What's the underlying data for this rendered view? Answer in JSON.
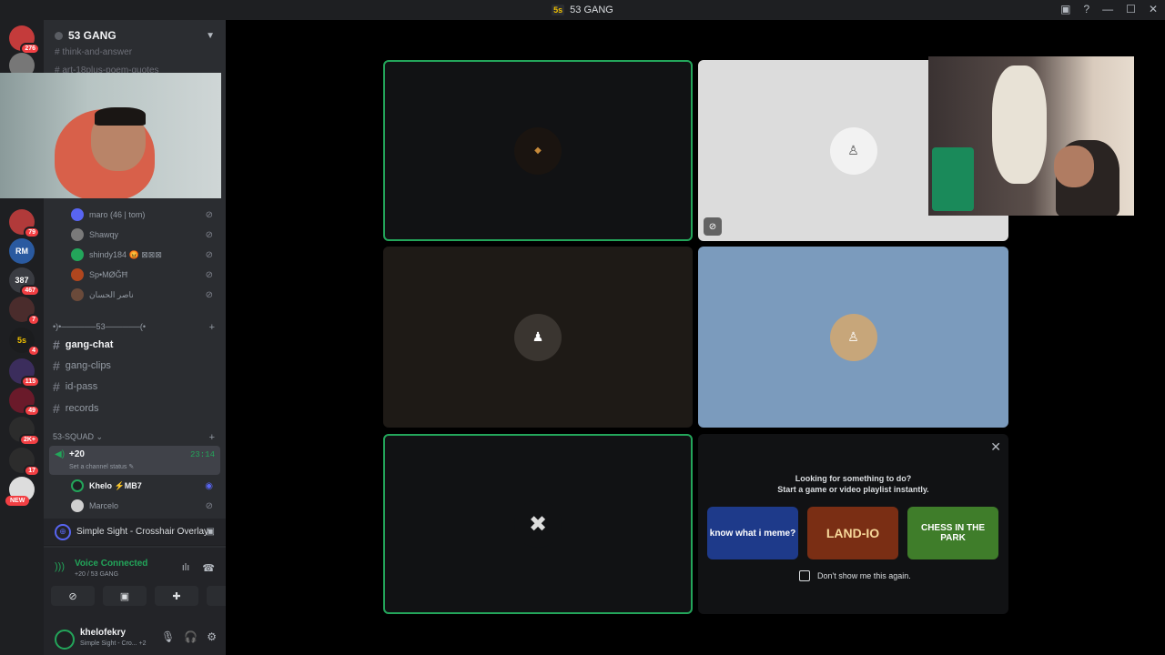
{
  "window": {
    "title": "53 GANG",
    "logo": "5s"
  },
  "guilds": [
    {
      "label": "",
      "badge": "276",
      "color": "#c43b3b"
    },
    {
      "label": "",
      "badge": "",
      "color": "#777"
    },
    {
      "label": "",
      "badge": "79",
      "color": "#b13a3a"
    },
    {
      "label": "RM",
      "badge": "",
      "color": "#2a5aa0"
    },
    {
      "label": "387",
      "badge": "467",
      "color": "#3a3c42"
    },
    {
      "label": "",
      "badge": "7",
      "color": "#4a2c2c"
    },
    {
      "label": "5s",
      "badge": "4",
      "color": "#1b1c1e"
    },
    {
      "label": "",
      "badge": "115",
      "color": "#3b2d5c"
    },
    {
      "label": "",
      "badge": "49",
      "color": "#6a1a2a"
    },
    {
      "label": "",
      "badge": "2K+",
      "color": "#2c2c2c"
    },
    {
      "label": "",
      "badge": "17",
      "color": "#2c2c2c"
    },
    {
      "label": "",
      "badge": "",
      "color": "#ddd"
    }
  ],
  "new_badge": "NEW",
  "server": {
    "name": "53 GANG"
  },
  "ghost_channels": [
    "think-and-answer",
    "art-18plus-poem-quotes"
  ],
  "voice_members_top": [
    {
      "name": "maro (46 | tom)",
      "color": "#5865f2"
    },
    {
      "name": "Shawqy",
      "color": "#7a7a7a"
    },
    {
      "name": "shindy184 😡 ⊠⊠⊠",
      "color": "#23a55a"
    },
    {
      "name": "Sp•MØĞĦ",
      "color": "#b0461e"
    },
    {
      "name": "ناصر الحسان",
      "color": "#6a4a3a"
    }
  ],
  "category1": "•)•──────53──────(•",
  "channels": [
    {
      "name": "gang-chat",
      "active": true
    },
    {
      "name": "gang-clips",
      "active": false
    },
    {
      "name": "id-pass",
      "active": false
    },
    {
      "name": "records",
      "active": false
    }
  ],
  "category2": "53-SQUAD",
  "voice_channel": {
    "name": "+20",
    "time": "23:14",
    "status": "Set a channel status ✎"
  },
  "voice_members": [
    {
      "name": "Khelo ⚡MB7",
      "color": "#1e1f22"
    },
    {
      "name": "Marcelo",
      "color": "#cfcfcf"
    }
  ],
  "activity": {
    "name": "Simple Sight - Crosshair Overlay"
  },
  "voice": {
    "status": "Voice Connected",
    "location": "+20 / 53 GANG"
  },
  "user": {
    "name": "khelofekry",
    "status": "Simple Sight - Cro... +2"
  },
  "prompt": {
    "title": "Looking for something to do?",
    "subtitle": "Start a game or video playlist instantly.",
    "cards": [
      {
        "label": "know what i meme?",
        "color": "#1e3a8a"
      },
      {
        "label": "LAND-IO",
        "color": "#7a2e14"
      },
      {
        "label": "CHESS IN THE PARK",
        "color": "#3f7d2a"
      }
    ],
    "checkbox": "Don't show me this again."
  },
  "icons": {
    "close": "close-icon",
    "mute": "mic-muted-icon"
  }
}
